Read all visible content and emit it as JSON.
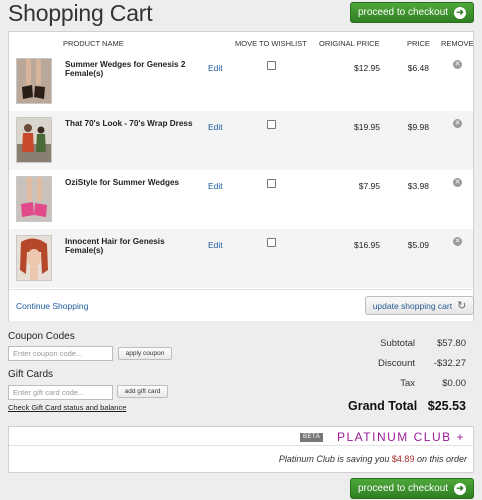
{
  "page": {
    "title": "Shopping Cart",
    "checkout_label": "proceed to checkout"
  },
  "cart": {
    "headers": {
      "product": "PRODUCT NAME",
      "wishlist": "MOVE TO WISHLIST",
      "original": "ORIGINAL PRICE",
      "price": "PRICE",
      "remove": "REMOVE"
    },
    "items": [
      {
        "name": "Summer Wedges for Genesis 2 Female(s)",
        "edit": "Edit",
        "original_price": "$12.95",
        "price": "$6.48"
      },
      {
        "name": "That 70's Look - 70's Wrap Dress",
        "edit": "Edit",
        "original_price": "$19.95",
        "price": "$9.98"
      },
      {
        "name": "OziStyle for Summer Wedges",
        "edit": "Edit",
        "original_price": "$7.95",
        "price": "$3.98"
      },
      {
        "name": "Innocent Hair for Genesis Female(s)",
        "edit": "Edit",
        "original_price": "$16.95",
        "price": "$5.09"
      }
    ],
    "continue_label": "Continue Shopping",
    "update_label": "update shopping cart"
  },
  "coupon": {
    "label": "Coupon Codes",
    "placeholder": "Enter coupon code...",
    "button": "apply coupon"
  },
  "gift": {
    "label": "Gift Cards",
    "placeholder": "Enter gift card code...",
    "button": "add gift card",
    "check_link": "Check Gift Card status and balance"
  },
  "summary": {
    "subtotal_label": "Subtotal",
    "subtotal": "$57.80",
    "discount_label": "Discount",
    "discount": "-$32.27",
    "tax_label": "Tax",
    "tax": "$0.00",
    "grand_label": "Grand Total",
    "grand": "$25.53"
  },
  "club": {
    "beta": "BETA",
    "name": "PLATINUM CLUB +",
    "msg_prefix": "Platinum Club is saving you",
    "saving": "$4.89",
    "msg_suffix": "on this order"
  }
}
